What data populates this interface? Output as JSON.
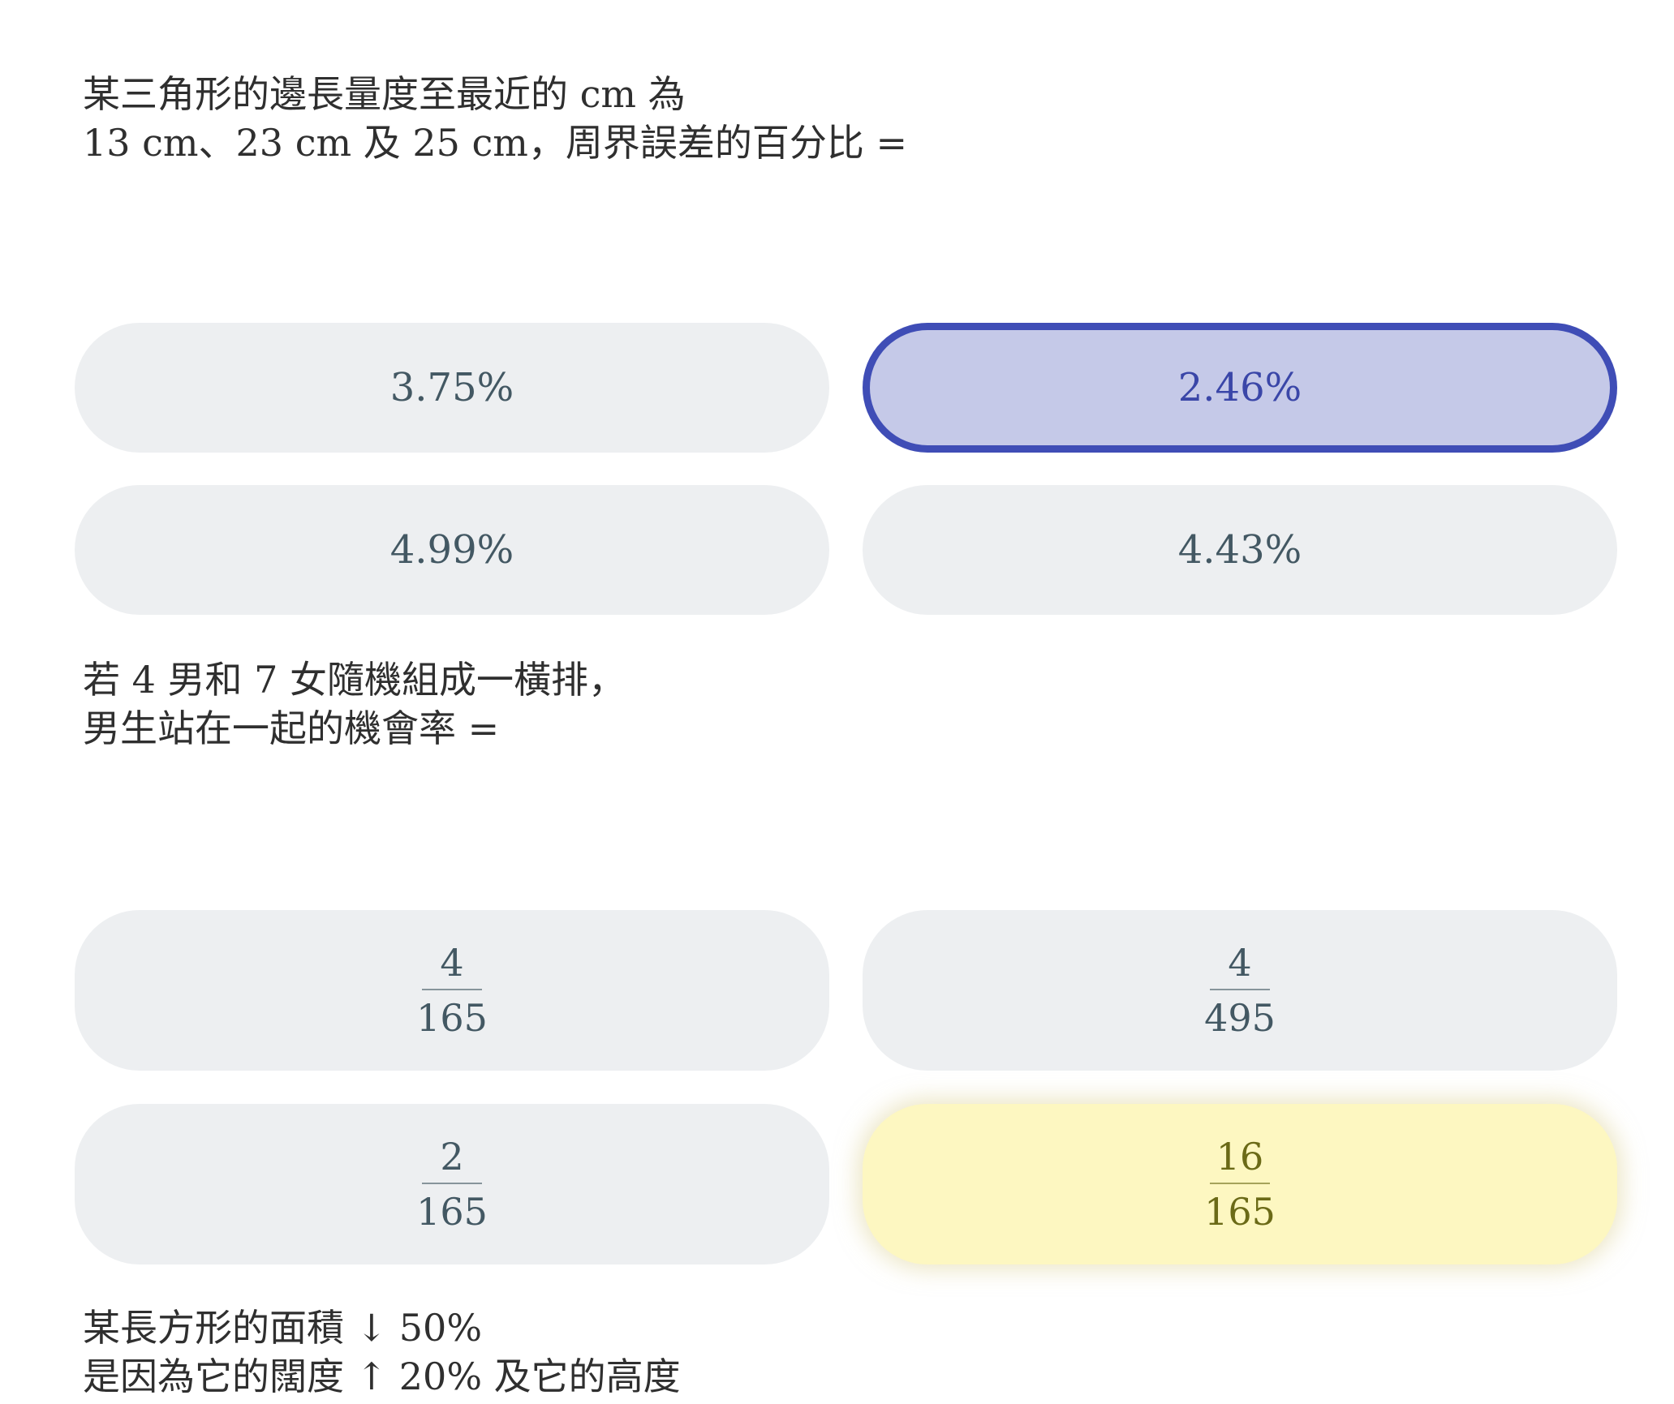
{
  "questions": [
    {
      "lines": [
        "某三角形的邊長量度至最近的 cm 為",
        "13 cm、23 cm 及 25 cm，周界誤差的百分比 ="
      ],
      "options": [
        {
          "label": "3.75%"
        },
        {
          "label": "2.46%",
          "state": "selected"
        },
        {
          "label": "4.99%"
        },
        {
          "label": "4.43%"
        }
      ]
    },
    {
      "lines": [
        "若 4 男和 7 女隨機組成一橫排，",
        "男生站在一起的機會率 ="
      ],
      "options": [
        {
          "numerator": "4",
          "denominator": "165"
        },
        {
          "numerator": "4",
          "denominator": "495"
        },
        {
          "numerator": "2",
          "denominator": "165"
        },
        {
          "numerator": "16",
          "denominator": "165",
          "state": "highlighted"
        }
      ]
    },
    {
      "lines": [
        "某長方形的面積 ↓ 50%",
        "是因為它的闊度 ↑ 20% 及它的高度"
      ]
    }
  ],
  "colors": {
    "option_bg": "#edeff1",
    "selected_bg": "#c5c9e8",
    "selected_border": "#3f4db6",
    "highlight_bg": "#fdf7c1"
  }
}
